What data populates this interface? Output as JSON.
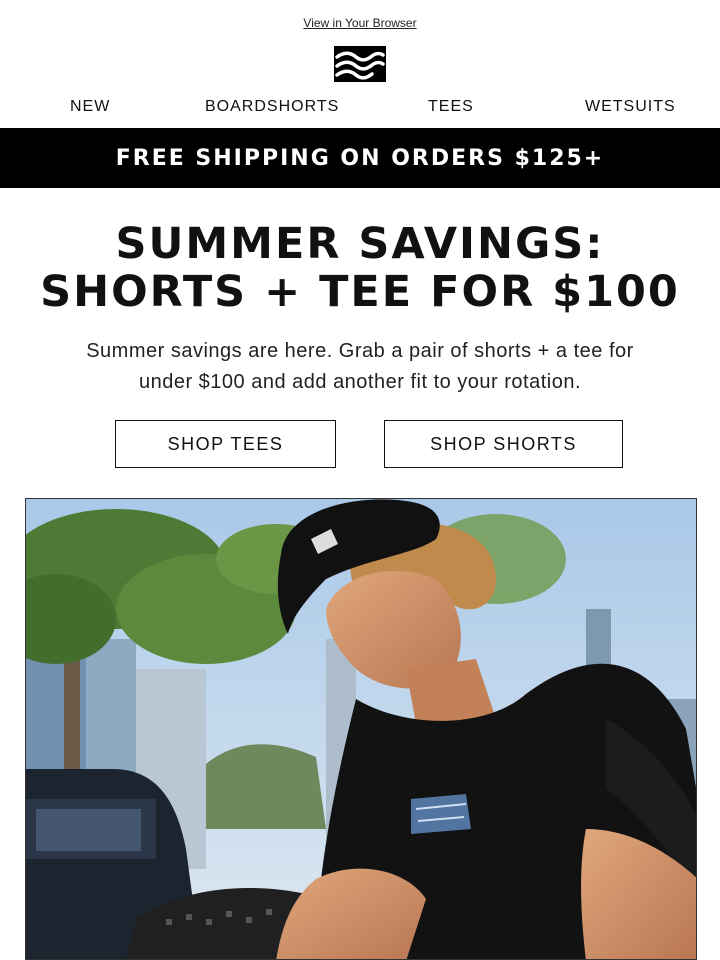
{
  "header": {
    "view_in_browser": "View in Your Browser",
    "logo_icon": "billabong-wave-logo"
  },
  "nav": {
    "items": [
      {
        "label": "NEW"
      },
      {
        "label": "BOARDSHORTS"
      },
      {
        "label": "TEES"
      },
      {
        "label": "WETSUITS"
      }
    ]
  },
  "promo_banner": {
    "text": "FREE SHIPPING ON ORDERS $125+"
  },
  "hero": {
    "headline_line1": "SUMMER SAVINGS:",
    "headline_line2": "SHORTS + TEE FOR $100",
    "body_line1": "Summer savings are here. Grab a pair of shorts + a tee for",
    "body_line2": "under $100 and add another fit to your rotation."
  },
  "buttons": {
    "shop_tees": "SHOP TEES",
    "shop_shorts": "SHOP SHORTS"
  },
  "colors": {
    "banner_bg": "#000000",
    "banner_text": "#ffffff",
    "page_bg": "#ffffff",
    "text": "#111111"
  }
}
